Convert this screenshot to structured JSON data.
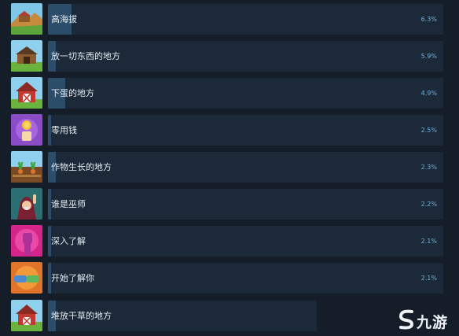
{
  "achievements": [
    {
      "title": "高海拔",
      "percent_text": "6.3%",
      "percent": 6.3,
      "icon": "ranch-hilltop-icon",
      "theme": "#d9a23a"
    },
    {
      "title": "放一切东西的地方",
      "percent_text": "5.9%",
      "percent": 5.9,
      "icon": "shed-icon",
      "theme": "#5fae3a"
    },
    {
      "title": "下蛋的地方",
      "percent_text": "4.9%",
      "percent": 4.9,
      "icon": "coop-icon",
      "theme": "#b33a2e"
    },
    {
      "title": "零用钱",
      "percent_text": "2.5%",
      "percent": 2.5,
      "icon": "coin-hand-icon",
      "theme": "#8c4cc8"
    },
    {
      "title": "作物生长的地方",
      "percent_text": "2.3%",
      "percent": 2.3,
      "icon": "crop-field-icon",
      "theme": "#5da53a"
    },
    {
      "title": "谁是巫师",
      "percent_text": "2.2%",
      "percent": 2.2,
      "icon": "wizard-icon",
      "theme": "#2b8a8a"
    },
    {
      "title": "深入了解",
      "percent_text": "2.1%",
      "percent": 2.1,
      "icon": "fist-icon",
      "theme": "#d6258a"
    },
    {
      "title": "开始了解你",
      "percent_text": "2.1%",
      "percent": 2.1,
      "icon": "handshake-icon",
      "theme": "#e0742a"
    },
    {
      "title": "堆放干草的地方",
      "percent_text": "",
      "percent": null,
      "icon": "barn-icon",
      "theme": "#4c9a3a"
    }
  ],
  "watermark": {
    "text": "九游"
  }
}
